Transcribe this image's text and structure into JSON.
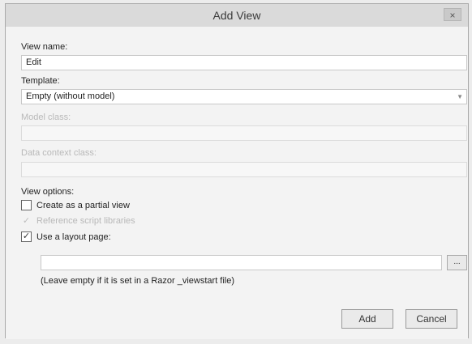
{
  "window": {
    "title": "Add View",
    "close_glyph": "×"
  },
  "form": {
    "view_name_label": "View name:",
    "view_name_value": "Edit",
    "template_label": "Template:",
    "template_value": "Empty (without model)",
    "model_class_label": "Model class:",
    "data_context_label": "Data context class:",
    "view_options_label": "View options:",
    "options": {
      "partial_view": {
        "label": "Create as a partial view",
        "checked": false
      },
      "reference_scripts": {
        "label": "Reference script libraries",
        "checked": true,
        "disabled": true
      },
      "use_layout": {
        "label": "Use a layout page:",
        "checked": true
      }
    },
    "layout_path_value": "",
    "browse_label": "...",
    "layout_hint": "(Leave empty if it is set in a Razor _viewstart file)"
  },
  "buttons": {
    "add": "Add",
    "cancel": "Cancel"
  },
  "icons": {
    "close": "close-icon",
    "dropdown": "chevron-down-icon",
    "check": "check-icon"
  }
}
